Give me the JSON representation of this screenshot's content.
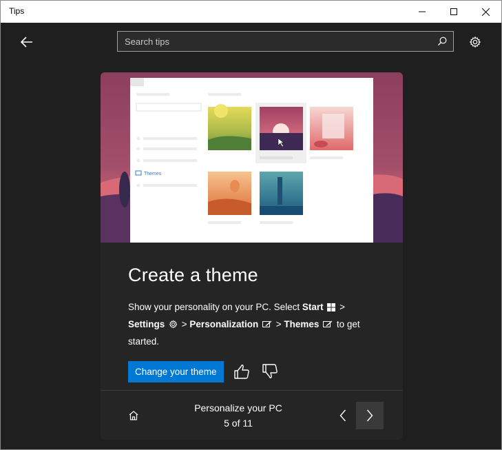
{
  "window": {
    "title": "Tips"
  },
  "search": {
    "placeholder": "Search tips"
  },
  "hero": {
    "themes_label": "Themes"
  },
  "tip": {
    "heading": "Create a theme",
    "desc_1": "Show your personality on your PC. Select ",
    "start": "Start",
    "gt1": " >",
    "settings": "Settings",
    "gt2": " > ",
    "personalization": "Personalization",
    "gt3": " > ",
    "themes": "Themes",
    "desc_end": " to get started.",
    "cta_label": "Change your theme"
  },
  "footer": {
    "collection_title": "Personalize your PC",
    "page_indicator": "5 of 11"
  },
  "colors": {
    "accent": "#0078d4",
    "card_bg": "#252525",
    "app_bg": "#1f1f1f"
  }
}
